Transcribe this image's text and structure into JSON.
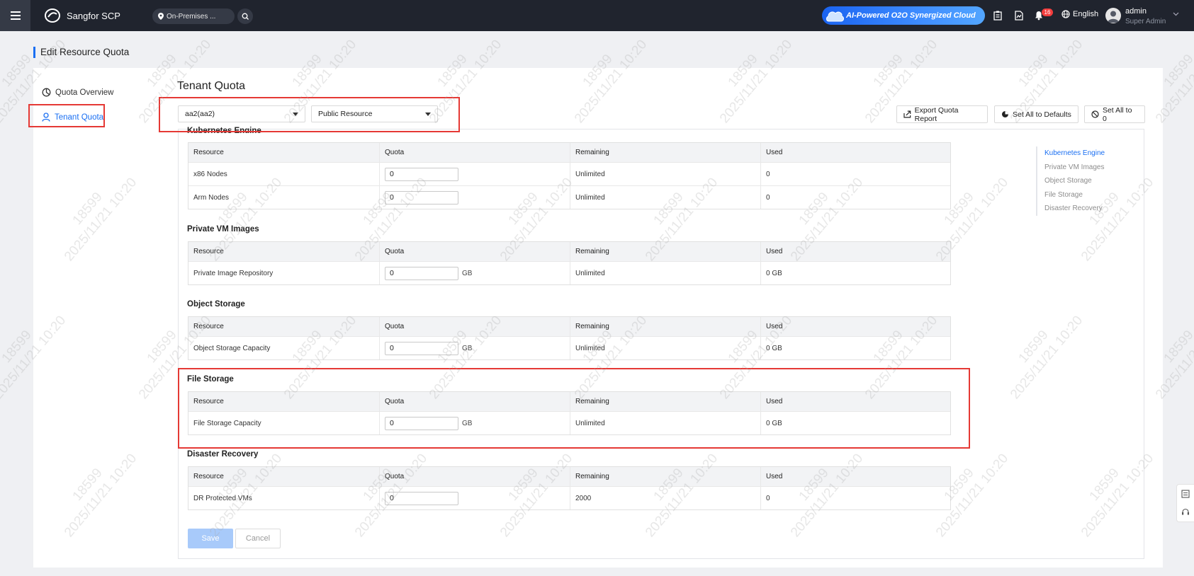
{
  "topbar": {
    "product": "Sangfor SCP",
    "region": "On-Premises ...",
    "promo": "AI-Powered O2O Synergized Cloud",
    "notification_count": "16",
    "language": "English",
    "user_name": "admin",
    "user_role": "Super Admin"
  },
  "page": {
    "title": "Edit Resource Quota"
  },
  "left_nav": {
    "items": [
      {
        "label": "Quota Overview",
        "icon": "quota-overview-icon"
      },
      {
        "label": "Tenant Quota",
        "icon": "user-icon",
        "active": true
      }
    ]
  },
  "main": {
    "title": "Tenant Quota",
    "tenant_select": "aa2(aa2)",
    "resource_select": "Public Resource",
    "toolbar": {
      "export": "Export Quota Report",
      "defaults": "Set All to Defaults",
      "zero": "Set All to 0"
    }
  },
  "columns": [
    "Resource",
    "Quota",
    "Remaining",
    "Used"
  ],
  "sections": {
    "kubernetes": {
      "title": "Kubernetes Engine",
      "rows": [
        {
          "resource": "x86 Nodes",
          "quota": "0",
          "unit": "",
          "remaining": "Unlimited",
          "used": "0"
        },
        {
          "resource": "Arm Nodes",
          "quota": "0",
          "unit": "",
          "remaining": "Unlimited",
          "used": "0"
        }
      ]
    },
    "vm_images": {
      "title": "Private VM Images",
      "rows": [
        {
          "resource": "Private Image Repository",
          "quota": "0",
          "unit": "GB",
          "remaining": "Unlimited",
          "used": "0 GB"
        }
      ]
    },
    "object_storage": {
      "title": "Object Storage",
      "rows": [
        {
          "resource": "Object Storage Capacity",
          "quota": "0",
          "unit": "GB",
          "remaining": "Unlimited",
          "used": "0 GB"
        }
      ]
    },
    "file_storage": {
      "title": "File Storage",
      "rows": [
        {
          "resource": "File Storage Capacity",
          "quota": "0",
          "unit": "GB",
          "remaining": "Unlimited",
          "used": "0 GB"
        }
      ]
    },
    "disaster_recovery": {
      "title": "Disaster Recovery",
      "rows": [
        {
          "resource": "DR Protected VMs",
          "quota": "0",
          "unit": "",
          "remaining": "2000",
          "used": "0"
        }
      ]
    }
  },
  "anchor_nav": [
    {
      "label": "Kubernetes Engine",
      "active": true
    },
    {
      "label": "Private VM Images"
    },
    {
      "label": "Object Storage"
    },
    {
      "label": "File Storage"
    },
    {
      "label": "Disaster Recovery"
    }
  ],
  "actions": {
    "save": "Save",
    "cancel": "Cancel"
  },
  "watermark": {
    "id": "18599",
    "timestamp": "2025/11/21 10:20"
  },
  "colors": {
    "accent": "#1a6ff2",
    "topbar": "#20242e",
    "annotation": "#e53935",
    "save_disabled": "#a8cafa"
  }
}
